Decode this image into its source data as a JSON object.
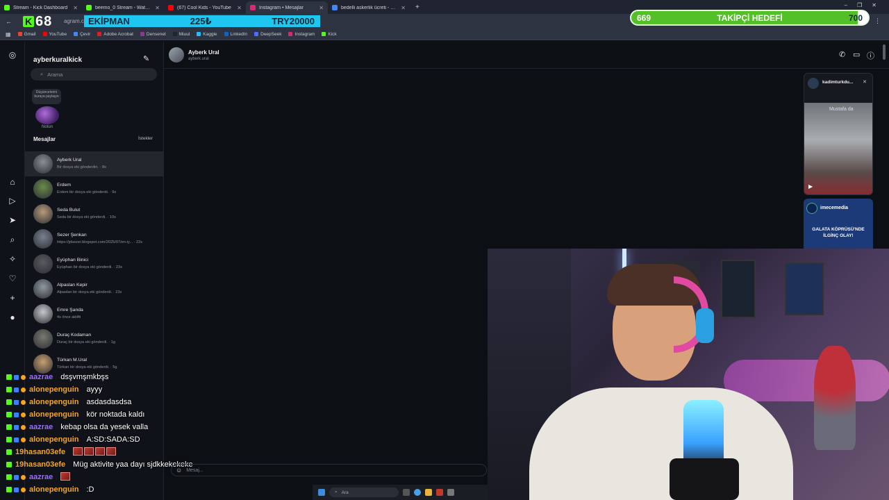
{
  "tabs": [
    {
      "title": "Stream - Kick Dashboard",
      "color": "#53fc18",
      "active": false
    },
    {
      "title": "beemo_0 Stream - Watch Live o",
      "color": "#53fc18",
      "active": false
    },
    {
      "title": "(67) Cool Kids - YouTube",
      "color": "#ff0000",
      "active": false
    },
    {
      "title": "Instagram • Mesajlar",
      "color": "#d62976",
      "active": true
    },
    {
      "title": "bedelli askerlik ücreti - Google",
      "color": "#4285f4",
      "active": false
    }
  ],
  "window_controls": {
    "minimize": "–",
    "restore": "❐",
    "close": "✕"
  },
  "address": {
    "url": "agram.com"
  },
  "bookmarks": [
    {
      "label": "Gmail",
      "color": "#ea4335"
    },
    {
      "label": "YouTube",
      "color": "#ff0000"
    },
    {
      "label": "Çevir",
      "color": "#4285f4"
    },
    {
      "label": "Adobe Acrobat",
      "color": "#e02020"
    },
    {
      "label": "Densenet",
      "color": "#8b3a8b"
    },
    {
      "label": "Miuul",
      "color": "#20242c"
    },
    {
      "label": "Kaggle",
      "color": "#20beff"
    },
    {
      "label": "LinkedIn",
      "color": "#0a66c2"
    },
    {
      "label": "DeepSeek",
      "color": "#4d6bfe"
    },
    {
      "label": "Instagram",
      "color": "#d62976"
    },
    {
      "label": "Kick",
      "color": "#53fc18"
    }
  ],
  "overlay": {
    "kick_count": "68",
    "ekipman_label": "EKİPMAN",
    "ekipman_price": "225₺",
    "ekipman_target": "TRY20000",
    "goal_current": "669",
    "goal_label": "TAKİPÇİ HEDEFİ",
    "goal_target": "700",
    "goal_fraction": 0.956
  },
  "instagram": {
    "username": "ayberkuralkick",
    "search_placeholder": "Arama",
    "note_text": "Düşüncelerini buraya paylaşın",
    "note_label": "Notun",
    "messages_header": "Mesajlar",
    "requests_label": "İstekler",
    "conversations": [
      {
        "name": "Ayberk Ural",
        "preview": "Bir dosya eki gönderdin. · 8s",
        "selected": true
      },
      {
        "name": "Erdem",
        "preview": "Erdem bir dosya eki gönderdi. · 9s",
        "selected": false
      },
      {
        "name": "Seda Bulut",
        "preview": "Seda bir dosya eki gönderdi. · 10s",
        "selected": false
      },
      {
        "name": "Sezer Şenkan",
        "preview": "https://jdsezer.blogspot.com/2025/07/en-iy... · 22s",
        "selected": false
      },
      {
        "name": "Eyüphan Binici",
        "preview": "Eyüphan bir dosya eki gönderdi. · 23s",
        "selected": false
      },
      {
        "name": "Alpaslan Kepir",
        "preview": "Alpaslan bir dosya eki gönderdi. · 23s",
        "selected": false
      },
      {
        "name": "Emre Şanda",
        "preview": "4s önce aktifti",
        "selected": false
      },
      {
        "name": "Duraç Kodaman",
        "preview": "Duraç bir dosya eki gönderdi. · 1g",
        "selected": false
      },
      {
        "name": "Türkan M.Ural",
        "preview": "Türkan bir dosya eki gönderdi. · 5g",
        "selected": false
      }
    ],
    "chat": {
      "name": "Ayberk Ural",
      "handle": "ayberk.ural",
      "message_placeholder": "Mesaj..."
    },
    "reels": [
      {
        "account": "kadimturkdu...",
        "caption": "Mustafa da"
      },
      {
        "account": "imecemedia",
        "headline": "GALATA KÖPRÜSÜ'NDE İLGİNÇ OLAY!"
      }
    ]
  },
  "stream_chat": [
    {
      "user": "aazrae",
      "color": "#9b6cff",
      "text": "dsşvmşmkbşs",
      "badges": [
        "kick",
        "blue",
        "orange"
      ]
    },
    {
      "user": "alonepenguin",
      "color": "#f5a524",
      "text": "ayyy",
      "badges": [
        "kick",
        "blue",
        "orange"
      ]
    },
    {
      "user": "alonepenguin",
      "color": "#f5a524",
      "text": "asdasdasdsa",
      "badges": [
        "kick",
        "blue",
        "orange"
      ]
    },
    {
      "user": "alonepenguin",
      "color": "#f5a524",
      "text": "kör noktada kaldı",
      "badges": [
        "kick",
        "blue",
        "orange"
      ]
    },
    {
      "user": "aazrae",
      "color": "#9b6cff",
      "text": "kebap olsa da yesek valla",
      "badges": [
        "kick",
        "blue",
        "orange"
      ]
    },
    {
      "user": "alonepenguin",
      "color": "#f5a524",
      "text": "A:SD:SADA:SD",
      "badges": [
        "kick",
        "blue",
        "orange"
      ]
    },
    {
      "user": "19hasan03efe",
      "color": "#f5a524",
      "text": "",
      "emotes": 4,
      "badges": [
        "kick"
      ]
    },
    {
      "user": "19hasan03efe",
      "color": "#f5a524",
      "text": "Müg aktivite yaa dayı sjdkkekekeke",
      "badges": [
        "kick"
      ]
    },
    {
      "user": "aazrae",
      "color": "#9b6cff",
      "text": "",
      "emotes": 1,
      "badges": [
        "kick",
        "blue",
        "orange"
      ]
    },
    {
      "user": "alonepenguin",
      "color": "#f5a524",
      "text": ":D",
      "badges": [
        "kick",
        "blue",
        "orange"
      ]
    }
  ],
  "taskbar": {
    "search_label": "Ara"
  }
}
